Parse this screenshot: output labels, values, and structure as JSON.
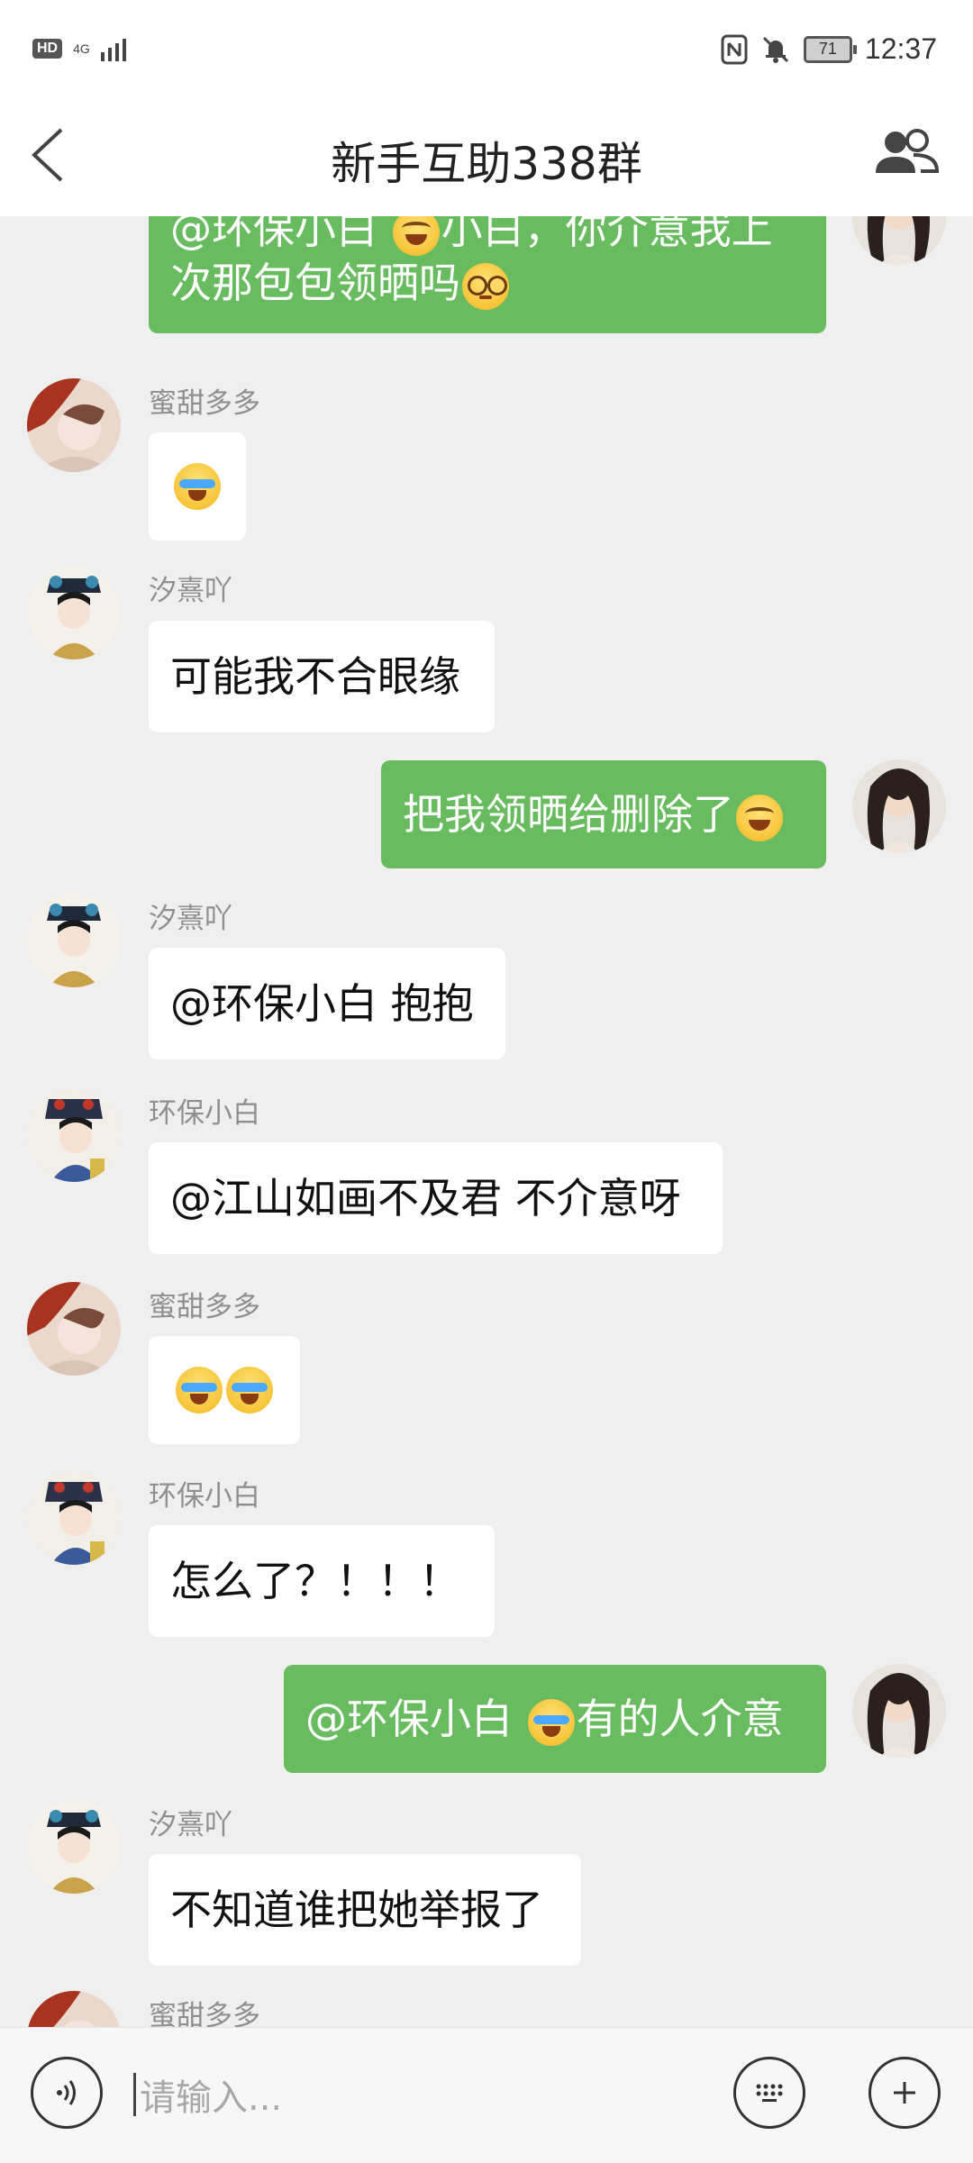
{
  "status_bar": {
    "hd_label": "HD",
    "network_label": "4G",
    "battery_level": "71",
    "time": "12:37",
    "icons": [
      "nfc-icon",
      "mute-icon"
    ]
  },
  "header": {
    "title": "新手互助338群",
    "back_icon": "chevron-left-icon",
    "members_icon": "group-members-icon"
  },
  "messages": [
    {
      "sender": "",
      "direction": "out",
      "text_before": "@环保小白 ",
      "emoji_1": "laugh",
      "text_mid": "小白，你介意我上次那包包领晒吗",
      "emoji_2": "glasses"
    },
    {
      "sender": "蜜甜多多",
      "direction": "in",
      "emoji": "cry"
    },
    {
      "sender": "汐熹吖",
      "direction": "in",
      "text": "可能我不合眼缘"
    },
    {
      "sender": "",
      "direction": "out",
      "text": "把我领晒给删除了",
      "emoji": "laugh"
    },
    {
      "sender": "汐熹吖",
      "direction": "in",
      "text": "@环保小白 抱抱"
    },
    {
      "sender": "环保小白",
      "direction": "in",
      "text": "@江山如画不及君 不介意呀"
    },
    {
      "sender": "蜜甜多多",
      "direction": "in",
      "emoji": "cry cry"
    },
    {
      "sender": "环保小白",
      "direction": "in",
      "text": "怎么了？！！！"
    },
    {
      "sender": "",
      "direction": "out",
      "text_before": "@环保小白 ",
      "emoji": "cry",
      "text_after": "有的人介意"
    },
    {
      "sender": "汐熹吖",
      "direction": "in",
      "text": "不知道谁把她举报了"
    },
    {
      "sender": "蜜甜多多",
      "direction": "in",
      "text": ""
    }
  ],
  "colors": {
    "background": "#efefef",
    "outgoing_bubble": "#68bb5e",
    "incoming_bubble": "#ffffff",
    "sender_name": "#8f8f8f"
  },
  "input_bar": {
    "placeholder": "请输入...",
    "voice_icon": "voice-icon",
    "keyboard_icon": "keyboard-icon",
    "plus_icon": "plus-icon"
  }
}
